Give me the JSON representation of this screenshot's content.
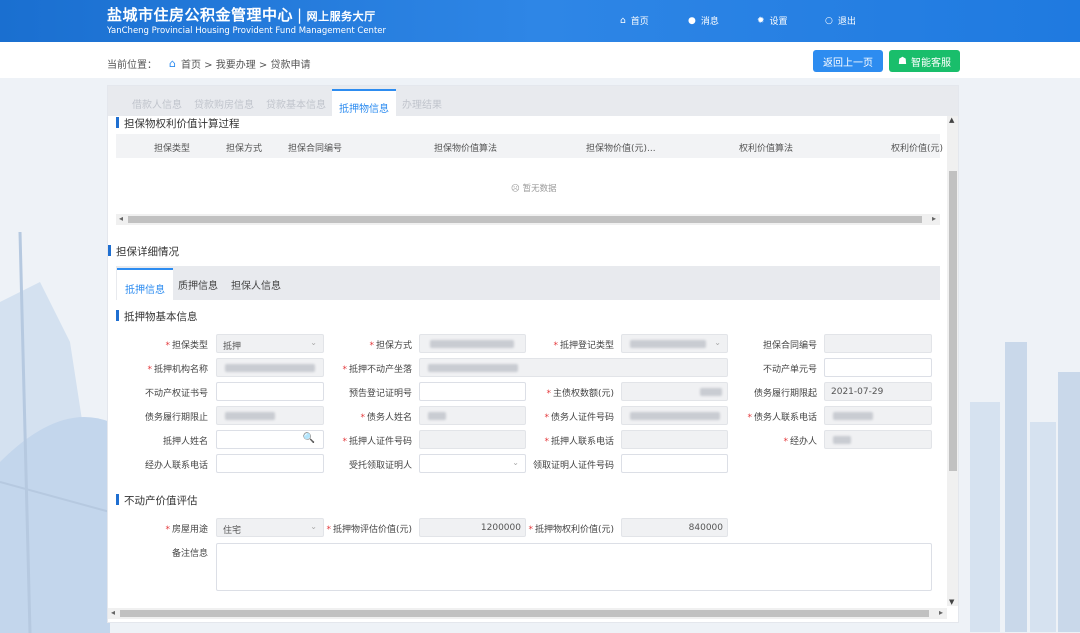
{
  "header": {
    "title_cn": "盐城市住房公积金管理中心",
    "divider": "|",
    "subtitle_cn": "网上服务大厅",
    "title_en": "YanCheng Provincial Housing Provident Fund Management Center",
    "nav": [
      {
        "label": "首页",
        "icon": "home-icon",
        "glyph": "⌂"
      },
      {
        "label": "消息",
        "icon": "message-icon",
        "glyph": "●"
      },
      {
        "label": "设置",
        "icon": "gear-icon",
        "glyph": "✹"
      },
      {
        "label": "退出",
        "icon": "power-icon",
        "glyph": "○"
      }
    ]
  },
  "breadcrumb": {
    "prefix": "当前位置：",
    "path": "首页 > 我要办理 > 贷款申请"
  },
  "actions": {
    "back": "返回上一页",
    "service": "智能客服"
  },
  "tabs": [
    {
      "label": "借款人信息",
      "active": false
    },
    {
      "label": "贷款购房信息",
      "active": false
    },
    {
      "label": "贷款基本信息",
      "active": false
    },
    {
      "label": "抵押物信息",
      "active": true
    },
    {
      "label": "办理结果",
      "active": false
    }
  ],
  "calc_section": {
    "title": "担保物权利价值计算过程",
    "columns": [
      "担保类型",
      "担保方式",
      "担保合同编号",
      "担保物价值算法",
      "担保物价值(元)...",
      "权利价值算法",
      "权利价值(元)"
    ],
    "empty_text": "暂无数据"
  },
  "guarantee_section": {
    "title": "担保详细情况",
    "subtabs": [
      {
        "label": "抵押信息",
        "active": true
      },
      {
        "label": "质押信息",
        "active": false
      },
      {
        "label": "担保人信息",
        "active": false
      }
    ]
  },
  "collateral_section": {
    "title": "抵押物基本信息",
    "fields": {
      "guarantee_type": {
        "label": "担保类型",
        "required": true,
        "value": "抵押"
      },
      "guarantee_method": {
        "label": "担保方式",
        "required": true,
        "value": ""
      },
      "mortgage_reg_type": {
        "label": "抵押登记类型",
        "required": true,
        "value": ""
      },
      "guarantee_contract_no": {
        "label": "担保合同编号",
        "required": false,
        "value": ""
      },
      "mortgagee_org": {
        "label": "抵押机构名称",
        "required": true,
        "value": ""
      },
      "property_location": {
        "label": "抵押不动产坐落",
        "required": true,
        "value": ""
      },
      "property_unit_no": {
        "label": "不动产单元号",
        "required": false,
        "value": ""
      },
      "property_cert_no": {
        "label": "不动产权证书号",
        "required": false,
        "value": ""
      },
      "prereg_cert_no": {
        "label": "预告登记证明号",
        "required": false,
        "value": ""
      },
      "principal_amount": {
        "label": "主债权数额(元)",
        "required": true,
        "value": ""
      },
      "debt_start": {
        "label": "债务履行期限起",
        "required": false,
        "value": "2021-07-29"
      },
      "debt_end": {
        "label": "债务履行期限止",
        "required": false,
        "value": ""
      },
      "debtor_name": {
        "label": "债务人姓名",
        "required": true,
        "value": ""
      },
      "debtor_id": {
        "label": "债务人证件号码",
        "required": true,
        "value": ""
      },
      "debtor_phone": {
        "label": "债务人联系电话",
        "required": true,
        "value": ""
      },
      "mortgagor_name": {
        "label": "抵押人姓名",
        "required": false,
        "value": ""
      },
      "mortgagor_id": {
        "label": "抵押人证件号码",
        "required": true,
        "value": ""
      },
      "mortgagor_phone": {
        "label": "抵押人联系电话",
        "required": true,
        "value": ""
      },
      "handler": {
        "label": "经办人",
        "required": true,
        "value": ""
      },
      "handler_phone": {
        "label": "经办人联系电话",
        "required": false,
        "value": ""
      },
      "proxy_receiver": {
        "label": "受托领取证明人",
        "required": false,
        "value": ""
      },
      "receiver_id": {
        "label": "领取证明人证件号码",
        "required": false,
        "value": ""
      }
    }
  },
  "valuation_section": {
    "title": "不动产价值评估",
    "fields": {
      "usage": {
        "label": "房屋用途",
        "required": true,
        "value": "住宅"
      },
      "appraised_value": {
        "label": "抵押物评估价值(元)",
        "required": true,
        "value": "1200000"
      },
      "right_value": {
        "label": "抵押物权利价值(元)",
        "required": true,
        "value": "840000"
      },
      "remarks": {
        "label": "备注信息",
        "required": false,
        "value": ""
      }
    }
  },
  "colors": {
    "primary": "#2d8cf0",
    "success": "#19be6b",
    "header": "#1f7ae0",
    "required": "#e4393c"
  }
}
